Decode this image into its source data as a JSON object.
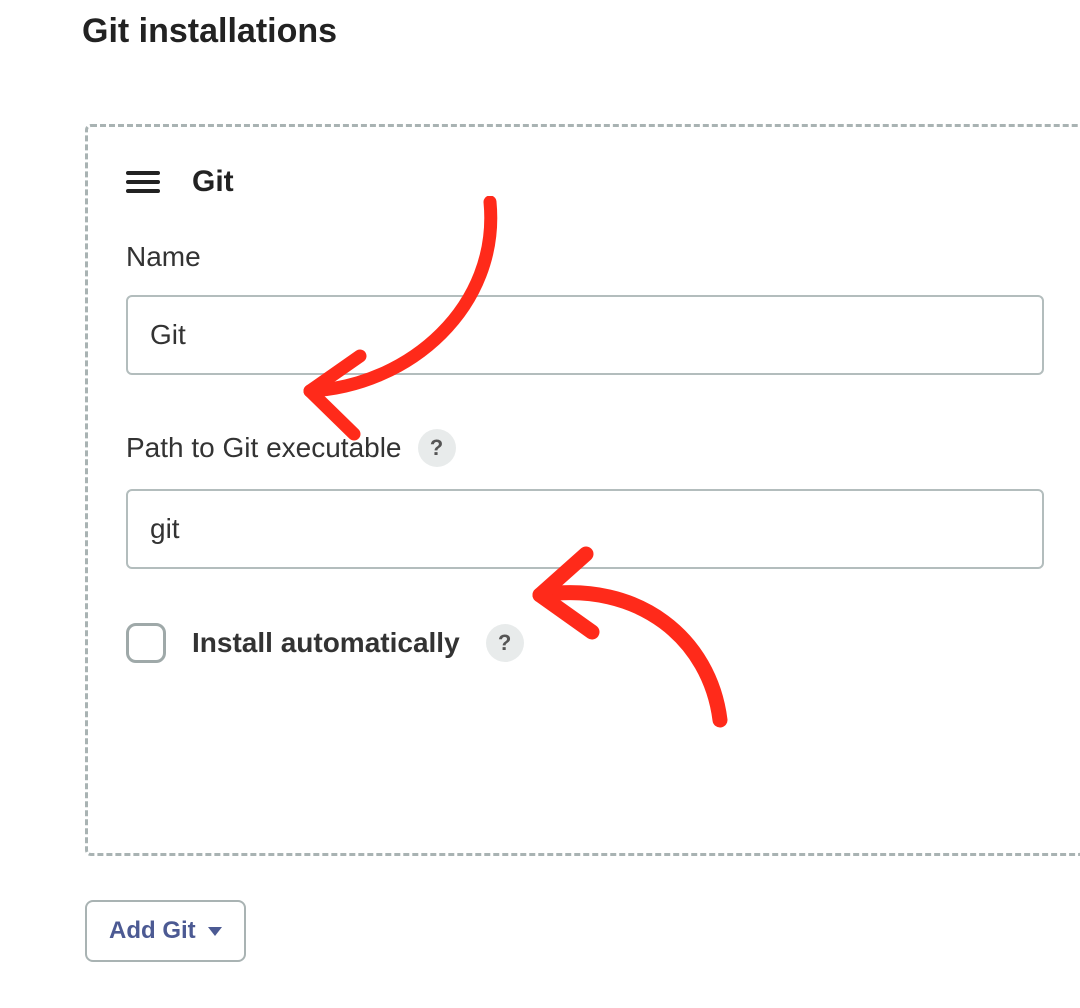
{
  "section": {
    "title": "Git installations"
  },
  "entry": {
    "title": "Git",
    "name_label": "Name",
    "name_value": "Git",
    "path_label": "Path to Git executable",
    "path_value": "git",
    "install_auto_label": "Install automatically",
    "install_auto_checked": false,
    "help_symbol": "?"
  },
  "actions": {
    "add_git_label": "Add Git"
  },
  "annotation": {
    "color": "#ff2a1a"
  }
}
